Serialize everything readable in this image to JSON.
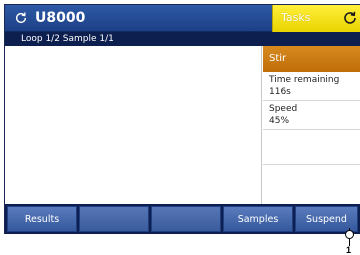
{
  "titlebar": {
    "title": "U8000",
    "tasks_label": "Tasks",
    "refresh_icon": "refresh-icon",
    "tasks_icon": "refresh-icon"
  },
  "subbar": {
    "status": "Loop 1/2 Sample 1/1"
  },
  "side_panel": {
    "header": "Stir",
    "fields": [
      {
        "label": "Time remaining",
        "value": "116s"
      },
      {
        "label": "Speed",
        "value": "45%"
      }
    ]
  },
  "bottom_tabs": [
    {
      "label": "Results"
    },
    {
      "label": ""
    },
    {
      "label": ""
    },
    {
      "label": "Samples"
    },
    {
      "label": "Suspend"
    }
  ],
  "callout": {
    "number": "1"
  },
  "colors": {
    "titlebar": "#1d3f86",
    "tasks": "#f2e000",
    "stir_header": "#c8780e",
    "subbar": "#0d1f4f"
  }
}
